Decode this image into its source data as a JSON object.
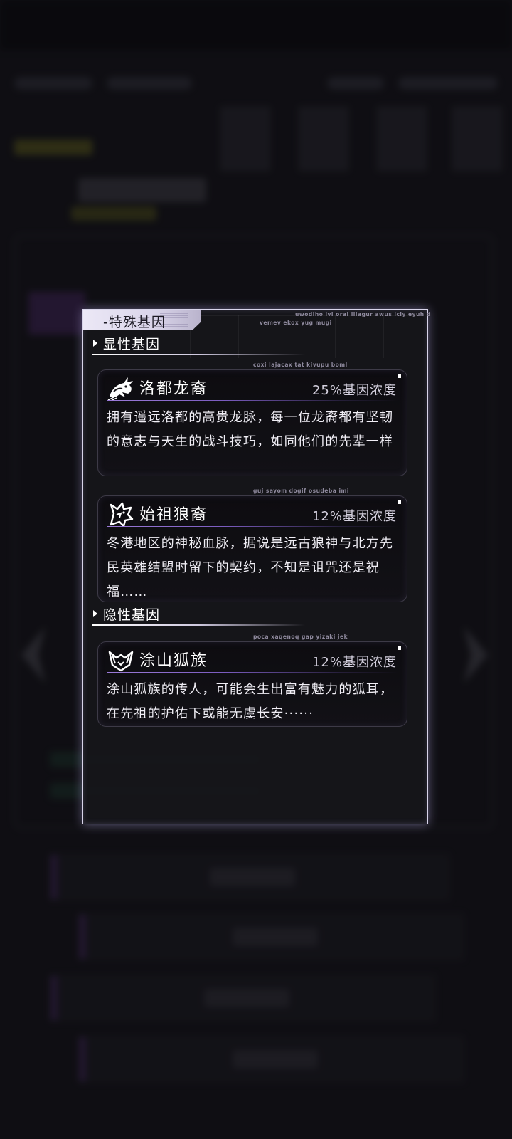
{
  "panel": {
    "title": "-特殊基因",
    "micro_text_1": "uwodiho ivi oral lilagur awus iciy eyuh d",
    "micro_text_2": "vemev ekox yug mugi"
  },
  "sections": [
    {
      "label": "显性基因",
      "genes": [
        {
          "icon": "dragon-icon",
          "name": "洛都龙裔",
          "concentration": "25%基因浓度",
          "micro_text": "coxi lajacax tat kivupu boml",
          "description": "拥有遥远洛都的高贵龙脉，每一位龙裔都有坚韧的意志与天生的战斗技巧，如同他们的先辈一样"
        },
        {
          "icon": "wolf-icon",
          "name": "始祖狼裔",
          "concentration": "12%基因浓度",
          "micro_text": "guj sayom dogif osudeba imi",
          "description": "冬港地区的神秘血脉，据说是远古狼神与北方先民英雄结盟时留下的契约，不知是诅咒还是祝福……"
        }
      ]
    },
    {
      "label": "隐性基因",
      "genes": [
        {
          "icon": "fox-icon",
          "name": "涂山狐族",
          "concentration": "12%基因浓度",
          "micro_text": "poca xaqenoq gap yizaki jek",
          "description": "涂山狐族的传人，可能会生出富有魅力的狐耳，在先祖的护佑下或能无虞长安······"
        }
      ]
    }
  ],
  "colors": {
    "accent_purple": "#9b7ad8",
    "border_light": "#d8d4ea",
    "card_bg": "#0d0c10"
  }
}
